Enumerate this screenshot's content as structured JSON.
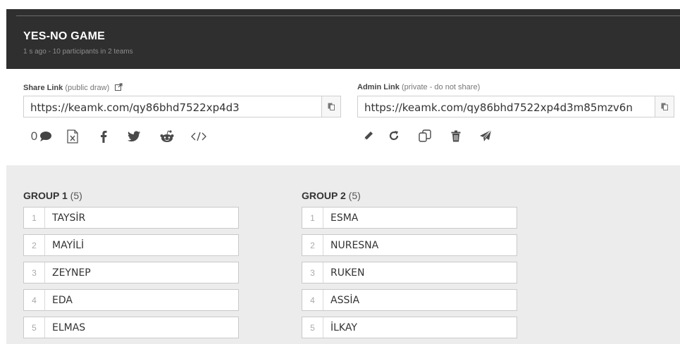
{
  "header": {
    "title": "YES-NO GAME",
    "subtitle": "1 s ago - 10 participants in 2 teams"
  },
  "share": {
    "label_bold": "Share Link",
    "label_note": "(public draw)",
    "url": "https://keamk.com/qy86bhd7522xp4d3",
    "comments_count": "0"
  },
  "admin": {
    "label_bold": "Admin Link",
    "label_note": "(private - do not share)",
    "url": "https://keamk.com/qy86bhd7522xp4d3m85mzv6n"
  },
  "groups": [
    {
      "title": "GROUP 1",
      "count": "(5)",
      "members": [
        {
          "num": "1",
          "name": "TAYSİR"
        },
        {
          "num": "2",
          "name": "MAYİLİ"
        },
        {
          "num": "3",
          "name": "ZEYNEP"
        },
        {
          "num": "4",
          "name": "EDA"
        },
        {
          "num": "5",
          "name": "ELMAS"
        }
      ]
    },
    {
      "title": "GROUP 2",
      "count": "(5)",
      "members": [
        {
          "num": "1",
          "name": "ESMA"
        },
        {
          "num": "2",
          "name": "NURESNA"
        },
        {
          "num": "3",
          "name": "RUKEN"
        },
        {
          "num": "4",
          "name": "ASSİA"
        },
        {
          "num": "5",
          "name": "İLKAY"
        }
      ]
    }
  ],
  "colors": {
    "header_bg": "#2f2f2f",
    "groups_bg": "#ececec"
  }
}
